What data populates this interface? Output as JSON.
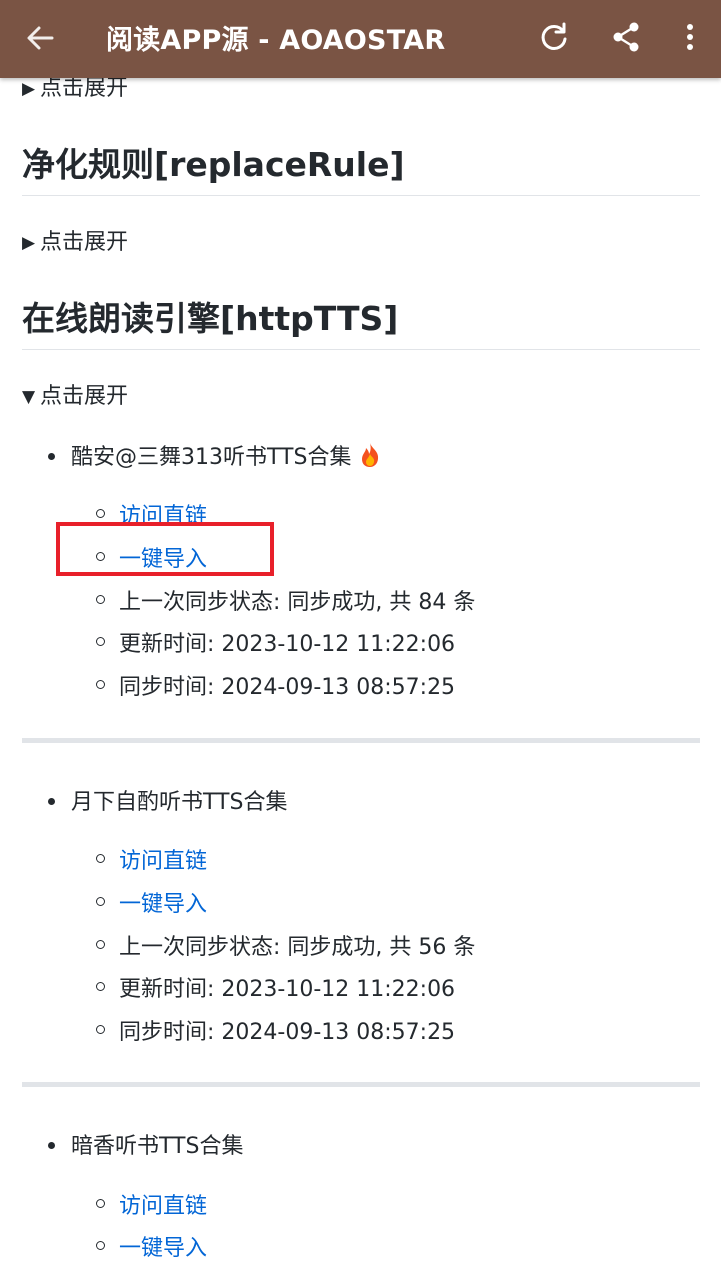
{
  "appbar": {
    "title": "阅读APP源 - AOAOSTAR",
    "icons": [
      "arrow-left-icon",
      "refresh-icon",
      "share-icon",
      "more-vert-icon"
    ],
    "background": "#7a5444"
  },
  "sections": {
    "top_summary": "点击展开",
    "replace_rule": {
      "heading": "净化规则[replaceRule]",
      "summary": "点击展开"
    },
    "http_tts": {
      "heading": "在线朗读引擎[httpTTS]",
      "summary": "点击展开"
    }
  },
  "sources": [
    {
      "name": "酷安@三舞313听书TTS合集",
      "has_fire_icon": true,
      "link_label": "访问直链",
      "import_label": "一键导入",
      "sync_status": "上一次同步状态: 同步成功, 共 84 条",
      "update_time": "更新时间: 2023-10-12 11:22:06",
      "sync_time": "同步时间: 2024-09-13 08:57:25"
    },
    {
      "name": "月下自酌听书TTS合集",
      "link_label": "访问直链",
      "import_label": "一键导入",
      "sync_status": "上一次同步状态: 同步成功, 共 56 条",
      "update_time": "更新时间: 2023-10-12 11:22:06",
      "sync_time": "同步时间: 2024-09-13 08:57:25"
    },
    {
      "name": "暗香听书TTS合集",
      "link_label": "访问直链",
      "import_label": "一键导入"
    }
  ],
  "colors": {
    "link": "#0366d6",
    "text": "#24292e",
    "divider": "#e1e4e8",
    "highlight_box": "#e8202a"
  }
}
